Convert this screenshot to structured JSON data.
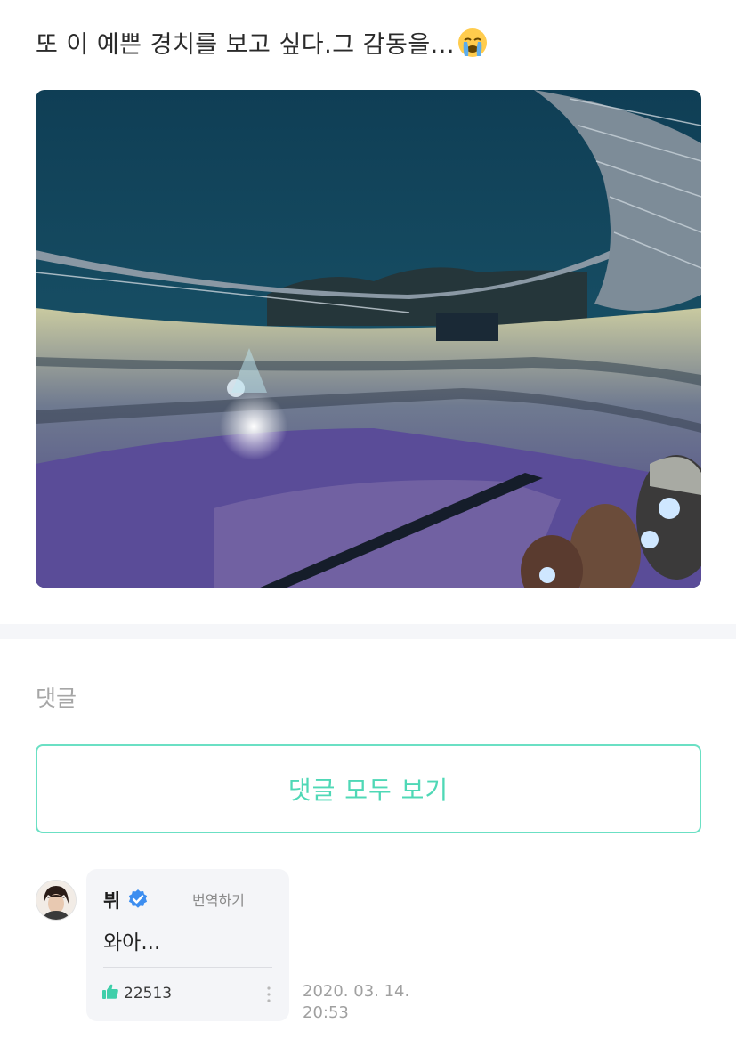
{
  "post": {
    "text": "또 이 예쁜 경치를 보고 싶다.그 감동을...",
    "emoji": "loudly-crying-face"
  },
  "photo": {
    "description_icon": "concert-stadium-photo"
  },
  "comments_section": {
    "label": "댓글",
    "view_all_label": "댓글 모두 보기"
  },
  "comment": {
    "author": "뷔",
    "verified": true,
    "translate_label": "번역하기",
    "body": "와아...",
    "like_count": "22513",
    "date": "2020. 03. 14.",
    "time": "20:53"
  },
  "colors": {
    "accent": "#4fd8b6",
    "verified_blue": "#3d8ef0",
    "bubble_bg": "#f4f5f8"
  }
}
